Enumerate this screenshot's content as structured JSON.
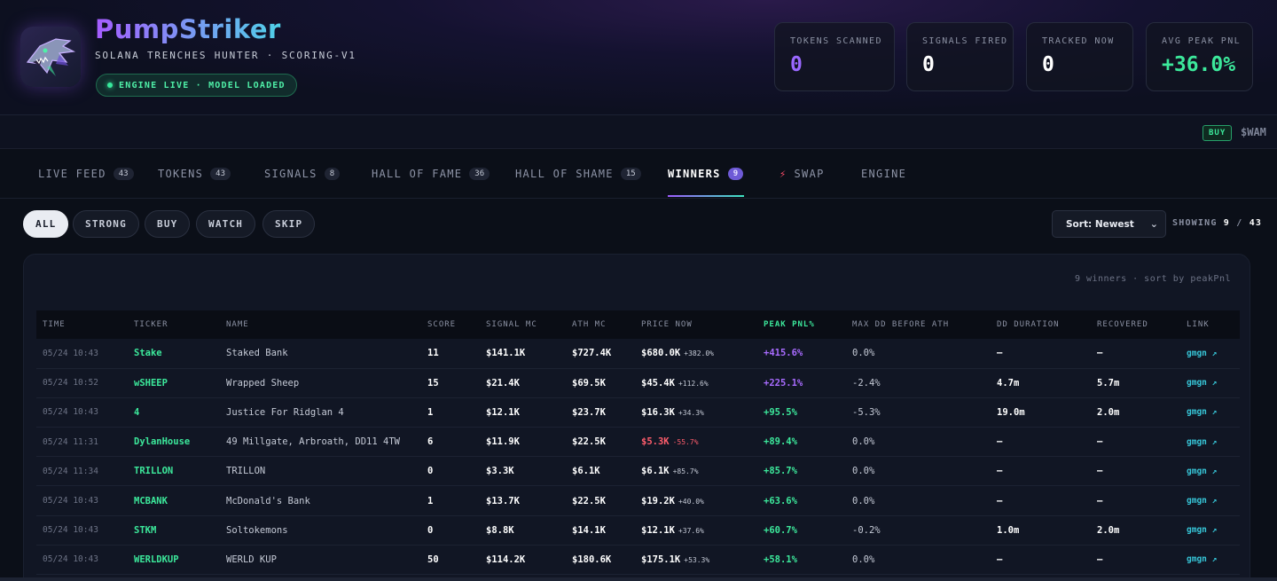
{
  "header": {
    "title": "PumpStriker",
    "subtitle": "SOLANA TRENCHES HUNTER · SCORING-V1",
    "badge": "ENGINE LIVE · MODEL LOADED",
    "logo_icon": "shark-logo-icon"
  },
  "stats": [
    {
      "label": "TOKENS SCANNED",
      "value": "0",
      "color": "#9a68ff"
    },
    {
      "label": "SIGNALS FIRED",
      "value": "0",
      "color": "#ffffff"
    },
    {
      "label": "TRACKED NOW",
      "value": "0",
      "color": "#ffffff"
    },
    {
      "label": "AVG PEAK PNL",
      "value": "+36.0%",
      "color": "#3ce89b"
    }
  ],
  "ticker": {
    "buy_label": "BUY",
    "symbol": "$WAM"
  },
  "tabs": [
    {
      "label": "LIVE FEED",
      "count": "43"
    },
    {
      "label": "TOKENS",
      "count": "43"
    },
    {
      "label": "SIGNALS",
      "count": "8"
    },
    {
      "label": "HALL OF FAME",
      "count": "36"
    },
    {
      "label": "HALL OF SHAME",
      "count": "15"
    },
    {
      "label": "WINNERS",
      "count": "9"
    },
    {
      "label": "SWAP",
      "count": ""
    },
    {
      "label": "ENGINE",
      "count": ""
    }
  ],
  "filters": [
    "ALL",
    "STRONG",
    "BUY",
    "WATCH",
    "SKIP"
  ],
  "sort": {
    "value": "Sort: Newest"
  },
  "showing": {
    "prefix": "SHOWING",
    "current": "9",
    "total": "43"
  },
  "panel": {
    "meta": "9 winners · sort by peakPnl"
  },
  "table": {
    "columns": [
      "TIME",
      "TICKER",
      "NAME",
      "SCORE",
      "SIGNAL MC",
      "ATH MC",
      "PRICE NOW",
      "PEAK PNL%",
      "MAX DD BEFORE ATH",
      "DD DURATION",
      "RECOVERED",
      "LINK"
    ],
    "rows": [
      {
        "time": "05/24 10:43",
        "ticker": "Stake",
        "name": "Staked Bank",
        "score": "11",
        "signal_mc": "$141.1K",
        "ath_mc": "$727.4K",
        "price": "$680.0K",
        "price_chg": "+382.0%",
        "peak": "+415.6%",
        "dd": "0.0%",
        "dd_dur": "—",
        "recovered": "—",
        "link": "gmgn ↗"
      },
      {
        "time": "05/24 10:52",
        "ticker": "wSHEEP",
        "name": "Wrapped Sheep",
        "score": "15",
        "signal_mc": "$21.4K",
        "ath_mc": "$69.5K",
        "price": "$45.4K",
        "price_chg": "+112.6%",
        "peak": "+225.1%",
        "dd": "-2.4%",
        "dd_dur": "4.7m",
        "recovered": "5.7m",
        "link": "gmgn ↗"
      },
      {
        "time": "05/24 10:43",
        "ticker": "4",
        "name": "Justice For Ridglan 4",
        "score": "1",
        "signal_mc": "$12.1K",
        "ath_mc": "$23.7K",
        "price": "$16.3K",
        "price_chg": "+34.3%",
        "peak": "+95.5%",
        "dd": "-5.3%",
        "dd_dur": "19.0m",
        "recovered": "2.0m",
        "link": "gmgn ↗"
      },
      {
        "time": "05/24 11:31",
        "ticker": "DylanHouse",
        "name": "49 Millgate, Arbroath, DD11 4TW",
        "score": "6",
        "signal_mc": "$11.9K",
        "ath_mc": "$22.5K",
        "price": "$5.3K",
        "price_chg": "-55.7%",
        "peak": "+89.4%",
        "dd": "0.0%",
        "dd_dur": "—",
        "recovered": "—",
        "link": "gmgn ↗"
      },
      {
        "time": "05/24 11:34",
        "ticker": "TRILLON",
        "name": "TRILLON",
        "score": "0",
        "signal_mc": "$3.3K",
        "ath_mc": "$6.1K",
        "price": "$6.1K",
        "price_chg": "+85.7%",
        "peak": "+85.7%",
        "dd": "0.0%",
        "dd_dur": "—",
        "recovered": "—",
        "link": "gmgn ↗"
      },
      {
        "time": "05/24 10:43",
        "ticker": "MCBANK",
        "name": "McDonald's Bank",
        "score": "1",
        "signal_mc": "$13.7K",
        "ath_mc": "$22.5K",
        "price": "$19.2K",
        "price_chg": "+40.0%",
        "peak": "+63.6%",
        "dd": "0.0%",
        "dd_dur": "—",
        "recovered": "—",
        "link": "gmgn ↗"
      },
      {
        "time": "05/24 10:43",
        "ticker": "STKM",
        "name": "Soltokemons",
        "score": "0",
        "signal_mc": "$8.8K",
        "ath_mc": "$14.1K",
        "price": "$12.1K",
        "price_chg": "+37.6%",
        "peak": "+60.7%",
        "dd": "-0.2%",
        "dd_dur": "1.0m",
        "recovered": "2.0m",
        "link": "gmgn ↗"
      },
      {
        "time": "05/24 10:43",
        "ticker": "WERLDKUP",
        "name": "WERLD KUP",
        "score": "50",
        "signal_mc": "$114.2K",
        "ath_mc": "$180.6K",
        "price": "$175.1K",
        "price_chg": "+53.3%",
        "peak": "+58.1%",
        "dd": "0.0%",
        "dd_dur": "—",
        "recovered": "—",
        "link": "gmgn ↗"
      }
    ]
  },
  "colors": {
    "peak_high": "#a86bff",
    "peak_normal": "#3ce89b",
    "negative": "#ff5d6c",
    "accent": "#3ce89b"
  }
}
